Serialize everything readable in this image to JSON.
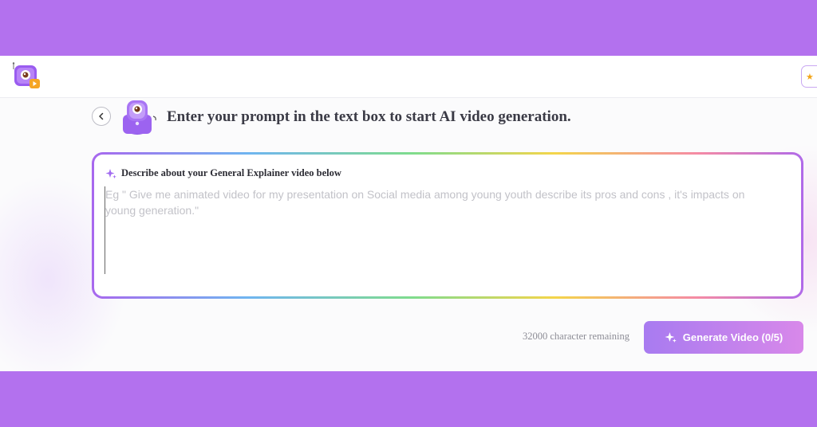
{
  "page": {
    "heading": "Enter your prompt in the text box to start AI video generation."
  },
  "prompt": {
    "label": "Describe about your General Explainer video below",
    "value": "",
    "placeholder": "Eg \" Give me animated video for my presentation on Social media among young youth describe its pros and cons , it's impacts on young generation.\""
  },
  "footer": {
    "char_remaining": "32000 character remaining",
    "generate_label": "Generate Video (0/5)"
  },
  "icons": {
    "logo": "app-logo-icon",
    "back": "chevron-left-icon",
    "mascot": "robot-mascot-icon",
    "sparkle": "sparkle-icon",
    "star": "star-icon"
  },
  "colors": {
    "background": "#b371ee",
    "accent_start": "#a87bf0",
    "accent_end": "#d888ea",
    "heading": "#3b3b46"
  }
}
